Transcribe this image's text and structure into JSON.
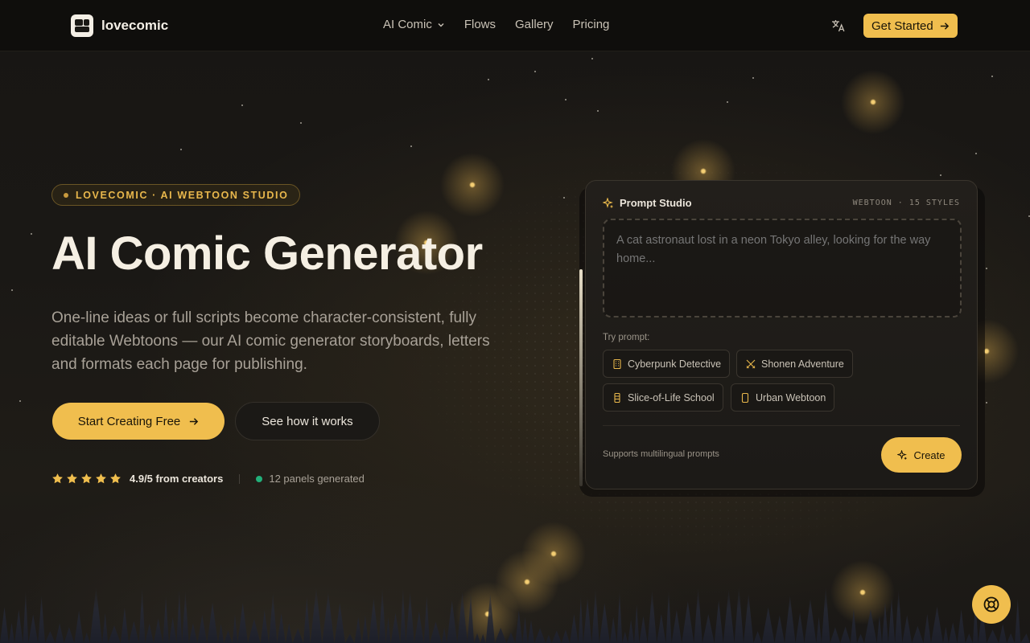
{
  "nav": {
    "brand": "lovecomic",
    "menu": [
      {
        "label": "AI Comic",
        "has_dropdown": true
      },
      {
        "label": "Flows"
      },
      {
        "label": "Gallery"
      },
      {
        "label": "Pricing"
      }
    ],
    "language_icon": "translate-icon",
    "cta_label": "Get Started"
  },
  "hero": {
    "badge": "LOVECOMIC · AI WEBTOON STUDIO",
    "title": "AI Comic Generator",
    "description": "One-line ideas or full scripts become character-consistent, fully editable Webtoons — our AI comic generator storyboards, letters and formats each page for publishing.",
    "primary_cta": "Start Creating Free",
    "secondary_cta": "See how it works",
    "rating_stars": 5,
    "rating_text": "4.9/5 from creators",
    "panels_text": "12 panels generated"
  },
  "prompt_card": {
    "title": "Prompt Studio",
    "meta": "WEBTOON · 15 STYLES",
    "placeholder": "A cat astronaut lost in a neon Tokyo alley, looking for the way home...",
    "try_label": "Try prompt:",
    "chips": [
      {
        "label": "Cyberpunk Detective",
        "icon": "building-icon"
      },
      {
        "label": "Shonen Adventure",
        "icon": "swords-icon"
      },
      {
        "label": "Slice-of-Life School",
        "icon": "school-icon"
      },
      {
        "label": "Urban Webtoon",
        "icon": "phone-icon"
      }
    ],
    "support_text": "Supports multilingual prompts",
    "create_label": "Create"
  },
  "colors": {
    "accent": "#f0be4e",
    "background": "#161412",
    "live_dot": "#22b07a"
  },
  "help_icon": "lifebuoy-icon"
}
